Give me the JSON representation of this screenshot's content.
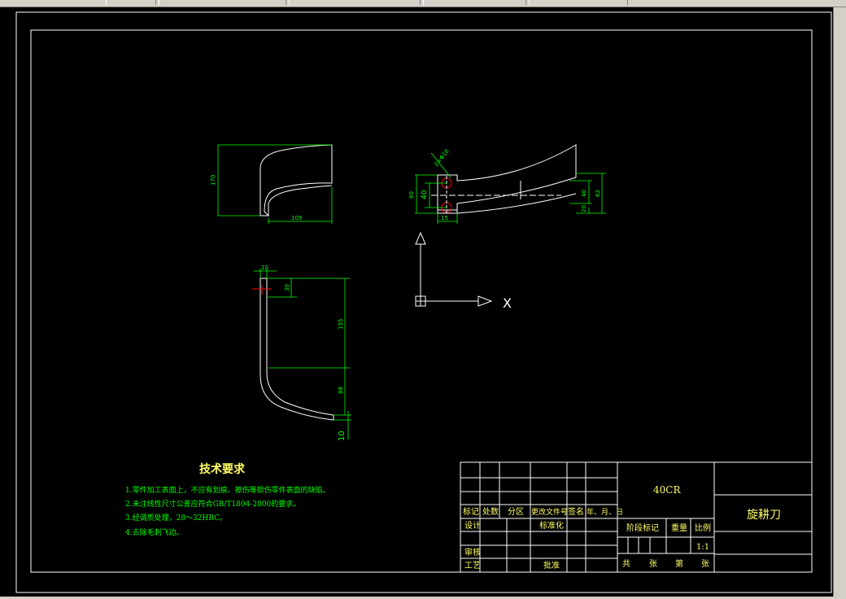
{
  "app": {
    "toolbar_segments": 6
  },
  "drawing": {
    "dimensions": {
      "front_height": "170",
      "front_width": "109",
      "top_hole": "2×Φ16",
      "top_d60": "60",
      "top_d40_left": "40",
      "top_d15": "15",
      "top_d40_right": "40",
      "top_d62": "62",
      "top_d20": "20",
      "side_d10_top": "10",
      "side_d30": "30",
      "side_d155": "155",
      "side_d88": "88",
      "side_d10_bottom": "10"
    },
    "ucs_x_label": "X"
  },
  "tech_requirements": {
    "title": "技术要求",
    "items": [
      "1.零件加工表面上，不应有划痕、擦伤等损伤零件表面的缺陷。",
      "2.未注线性尺寸公差应符合GB/T1804-2000的要求。",
      "3.经调质处理，28～32HRC。",
      "4.去除毛刺飞边。"
    ]
  },
  "title_block": {
    "material": "40CR",
    "part_name": "旋耕刀",
    "rev_headers": [
      "标记",
      "处数",
      "分区",
      "更改文件号",
      "签名",
      "年、月、日"
    ],
    "roles": {
      "design": "设计",
      "standard": "标准化",
      "review": "审核",
      "process": "工艺",
      "approve": "批准"
    },
    "stage_label": "阶段标记",
    "weight_label": "重量",
    "scale_label": "比例",
    "scale_value": "1:1",
    "sheet_chars": [
      "共",
      "张",
      "第",
      "张"
    ]
  }
}
